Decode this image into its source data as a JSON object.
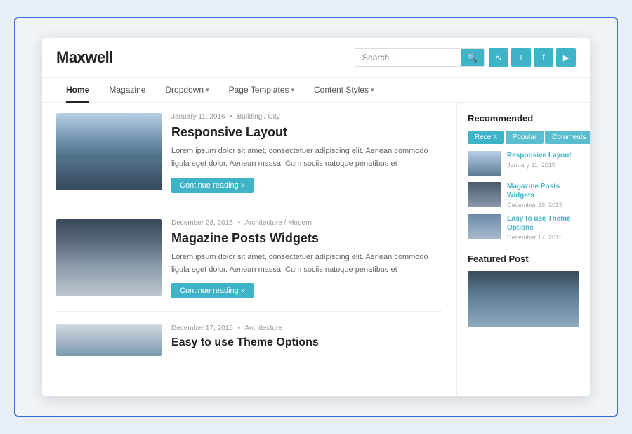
{
  "site": {
    "logo": "Maxwell",
    "search_placeholder": "Search ...",
    "search_button_icon": "🔍",
    "social_icons": [
      "rss",
      "twitter",
      "facebook",
      "youtube"
    ]
  },
  "nav": {
    "items": [
      {
        "label": "Home",
        "active": true,
        "has_dropdown": false
      },
      {
        "label": "Magazine",
        "active": false,
        "has_dropdown": false
      },
      {
        "label": "Dropdown",
        "active": false,
        "has_dropdown": true
      },
      {
        "label": "Page Templates",
        "active": false,
        "has_dropdown": true
      },
      {
        "label": "Content Styles",
        "active": false,
        "has_dropdown": true
      }
    ]
  },
  "posts": [
    {
      "date": "January 11, 2016",
      "category": "Building / City",
      "title": "Responsive Layout",
      "excerpt": "Lorem ipsum dolor sit amet, consectetuer adipiscing elit. Aenean commodo ligula eget dolor. Aenean massa. Cum sociis natoque penatibus et",
      "read_more": "Continue reading »",
      "thumb_type": "building"
    },
    {
      "date": "December 28, 2015",
      "category": "Architecture / Modern",
      "title": "Magazine Posts Widgets",
      "excerpt": "Lorem ipsum dolor sit amet, consectetuer adipiscing elit. Aenean commodo ligula eget dolor. Aenean massa. Cum sociis natoque penatibus et",
      "read_more": "Continue reading »",
      "thumb_type": "observatory"
    },
    {
      "date": "December 17, 2015",
      "category": "Architecture",
      "title": "Easy to use Theme Options",
      "excerpt": "",
      "read_more": "",
      "thumb_type": "partial"
    }
  ],
  "sidebar": {
    "recommended_title": "Recommended",
    "tabs": [
      "Recent",
      "Popular",
      "Comments"
    ],
    "recommended_items": [
      {
        "title": "Responsive Layout",
        "date": "January 11, 2015",
        "thumb_type": "rec1"
      },
      {
        "title": "Magazine Posts Widgets",
        "date": "December 28, 2015",
        "thumb_type": "rec2"
      },
      {
        "title": "Easy to use Theme Options",
        "date": "December 17, 2015",
        "thumb_type": "rec3"
      }
    ],
    "featured_title": "Featured Post"
  }
}
